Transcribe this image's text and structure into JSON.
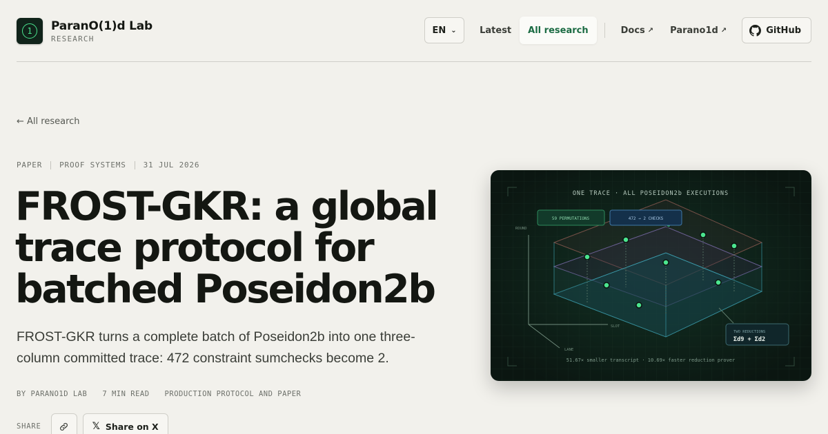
{
  "header": {
    "brand_name": "ParanO(1)d Lab",
    "brand_sub": "RESEARCH",
    "logo_glyph": "1",
    "language": "EN",
    "nav": [
      {
        "label": "Latest",
        "active": false
      },
      {
        "label": "All research",
        "active": true
      },
      {
        "label": "Docs",
        "external": true
      },
      {
        "label": "Parano1d",
        "external": true
      }
    ],
    "external_glyph": "↗",
    "github_label": "GitHub"
  },
  "article": {
    "back_label": "← All research",
    "meta": [
      "PAPER",
      "PROOF SYSTEMS",
      "31 JUL 2026"
    ],
    "title": "FROST-GKR: a global trace protocol for batched Poseidon2b",
    "lede": "FROST-GKR turns a complete batch of Poseidon2b into one three-column committed trace: 472 constraint sumchecks become 2.",
    "byline": [
      "BY PARANO1D LAB",
      "7 MIN READ",
      "PRODUCTION PROTOCOL AND PAPER"
    ],
    "share_label": "SHARE",
    "share_x_label": "Share on X"
  },
  "figure": {
    "title": "ONE TRACE · ALL POSEIDON2b EXECUTIONS",
    "badge_left": "59 PERMUTATIONS",
    "badge_right": "472 → 2 CHECKS",
    "axis_round": "ROUND",
    "axis_slot": "SLOT",
    "axis_lane": "LANE",
    "reductions_label": "TWO REDUCTIONS",
    "reductions_value": "Σd9 + Σd2",
    "caption": "51.67× smaller transcript · 10.69× faster reduction prover"
  },
  "colors": {
    "accent_green": "#1b6b43",
    "node_green": "#4be58f",
    "figure_bg": "#0d1a14"
  }
}
